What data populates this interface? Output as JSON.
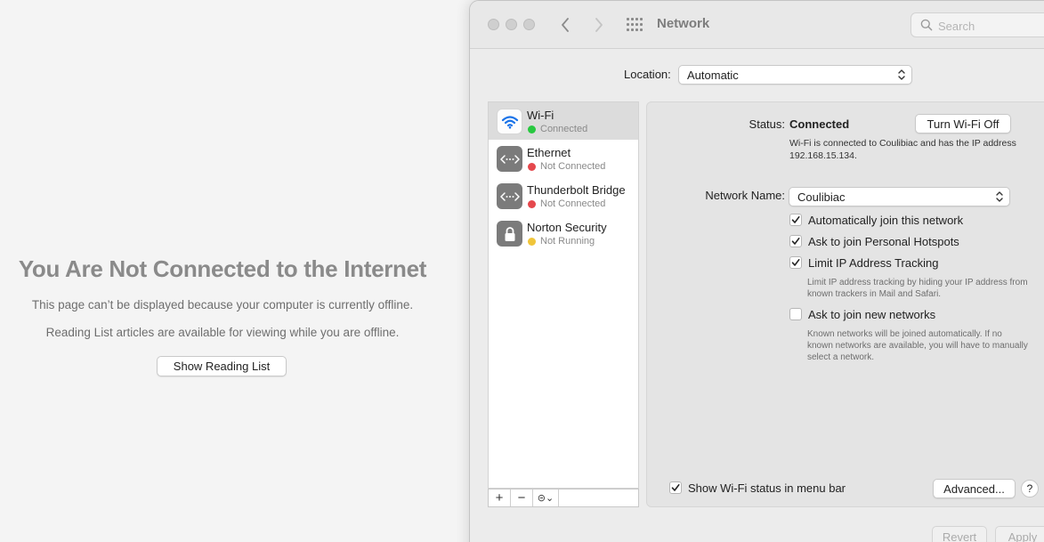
{
  "safari": {
    "title": "You Are Not Connected to the Internet",
    "message1": "This page can’t be displayed because your computer is currently offline.",
    "message2": "Reading List articles are available for viewing while you are offline.",
    "button": "Show Reading List"
  },
  "window": {
    "title": "Network",
    "search_placeholder": "Search"
  },
  "location": {
    "label": "Location:",
    "value": "Automatic"
  },
  "services": [
    {
      "name": "Wi-Fi",
      "status": "Connected",
      "status_color": "#28c840",
      "icon": "wifi-icon"
    },
    {
      "name": "Ethernet",
      "status": "Not Connected",
      "status_color": "#e5484d",
      "icon": "ethernet-icon"
    },
    {
      "name": "Thunderbolt Bridge",
      "status": "Not Connected",
      "status_color": "#e5484d",
      "icon": "thunderbolt-icon"
    },
    {
      "name": "Norton Security",
      "status": "Not Running",
      "status_color": "#f0c53a",
      "icon": "lock-icon"
    }
  ],
  "toolbar": {
    "add": "+",
    "remove": "−",
    "action": "⊝⌄"
  },
  "detail": {
    "status_label": "Status:",
    "status_value": "Connected",
    "turn_off_label": "Turn Wi-Fi Off",
    "status_description": "Wi-Fi is connected to Coulibiac and has the IP address 192.168.15.134.",
    "network_name_label": "Network Name:",
    "network_name_value": "Coulibiac",
    "options": [
      {
        "label": "Automatically join this network",
        "checked": true,
        "description": ""
      },
      {
        "label": "Ask to join Personal Hotspots",
        "checked": true,
        "description": ""
      },
      {
        "label": "Limit IP Address Tracking",
        "checked": true,
        "description": "Limit IP address tracking by hiding your IP address from known trackers in Mail and Safari."
      },
      {
        "label": "Ask to join new networks",
        "checked": false,
        "description": "Known networks will be joined automatically. If no known networks are available, you will have to manually select a network."
      }
    ],
    "show_status_label": "Show Wi-Fi status in menu bar",
    "show_status_checked": true,
    "advanced_label": "Advanced...",
    "help_label": "?"
  },
  "footer": {
    "revert_label": "Revert",
    "apply_label": "Apply"
  },
  "colors": {
    "wifi_blue": "#1a73e8",
    "selected_row": "#dcdcdc"
  }
}
